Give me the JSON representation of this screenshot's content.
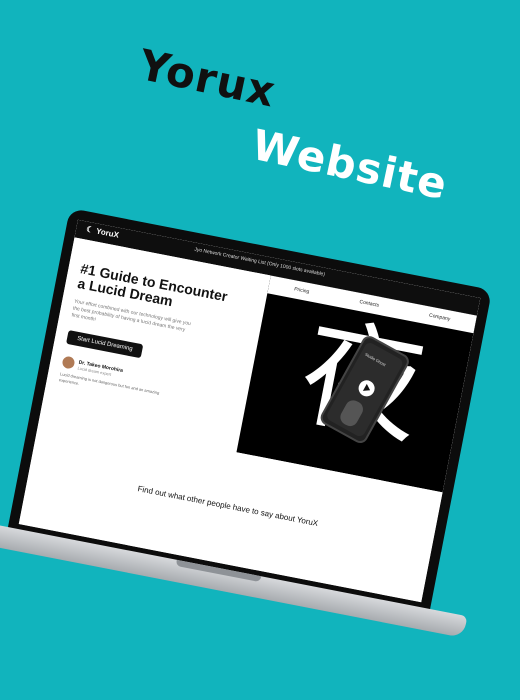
{
  "heading_line_1": "Yorux",
  "heading_line_2": "Website",
  "site": {
    "brand": "YoruX",
    "notice": "Jyo Network Creator Waiting List (Only 1000 slots available)",
    "nav": [
      "Pricing",
      "Contacts",
      "Company"
    ],
    "hero_title": "#1 Guide to Encounter a Lucid Dream",
    "hero_description": "Your effort combined with our technology will give you the best probability of having a lucid dream the very first month!",
    "cta": "Start Lucid Dreaming",
    "author_name": "Dr. Takeo Morohira",
    "author_role": "Lucid dream expert",
    "quote": "Lucid dreaming is not dangerous but fun and an amazing experience.",
    "kanji": "夜",
    "phone_caption": "Studio Ghost",
    "testimonials_heading": "Find out what other people have to say about YoruX"
  },
  "colors": {
    "background": "#11b4bd",
    "title_dark": "#101010",
    "title_light": "#ffffff"
  },
  "icons": [
    "moon-icon",
    "play-icon"
  ]
}
